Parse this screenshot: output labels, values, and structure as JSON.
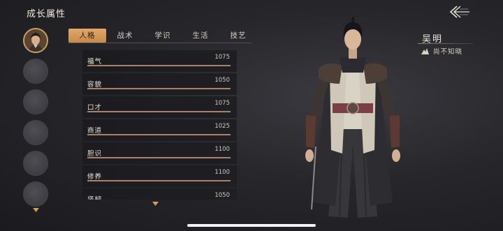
{
  "header": {
    "title": "成长属性"
  },
  "characters": {
    "slots": 6
  },
  "tabs": [
    {
      "label": "人格",
      "active": true
    },
    {
      "label": "战术",
      "active": false
    },
    {
      "label": "学识",
      "active": false
    },
    {
      "label": "生活",
      "active": false
    },
    {
      "label": "技艺",
      "active": false
    }
  ],
  "attributes": [
    {
      "name": "福气",
      "value": "1075",
      "fill": 1.0
    },
    {
      "name": "容貌",
      "value": "1050",
      "fill": 1.0
    },
    {
      "name": "口才",
      "value": "1075",
      "fill": 1.0
    },
    {
      "name": "商道",
      "value": "1025",
      "fill": 1.0
    },
    {
      "name": "胆识",
      "value": "1100",
      "fill": 1.0
    },
    {
      "name": "修养",
      "value": "1100",
      "fill": 1.0
    },
    {
      "name": "坚韧",
      "value": "1050",
      "fill": 1.0
    }
  ],
  "hero": {
    "name": "吴明",
    "status": "尚不知晓"
  },
  "colors": {
    "accent": "#d89a5a",
    "bar_fill": "#a8826a",
    "slot_border": "#c9a062"
  },
  "icons": {
    "back": "back-arrow-icon",
    "down": "chevron-down-icon",
    "status": "mountain-icon"
  }
}
